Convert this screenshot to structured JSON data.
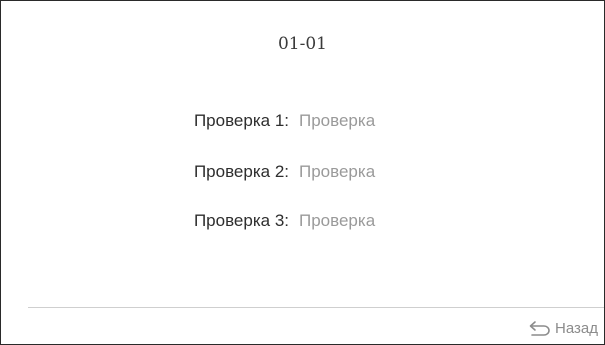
{
  "screen": {
    "title": "01-01"
  },
  "rows": [
    {
      "label": "Проверка 1:",
      "value": "Проверка"
    },
    {
      "label": "Проверка 2:",
      "value": "Проверка"
    },
    {
      "label": "Проверка 3:",
      "value": "Проверка"
    }
  ],
  "footer": {
    "back_label": "Назад",
    "back_icon": "return-arrow-icon"
  }
}
